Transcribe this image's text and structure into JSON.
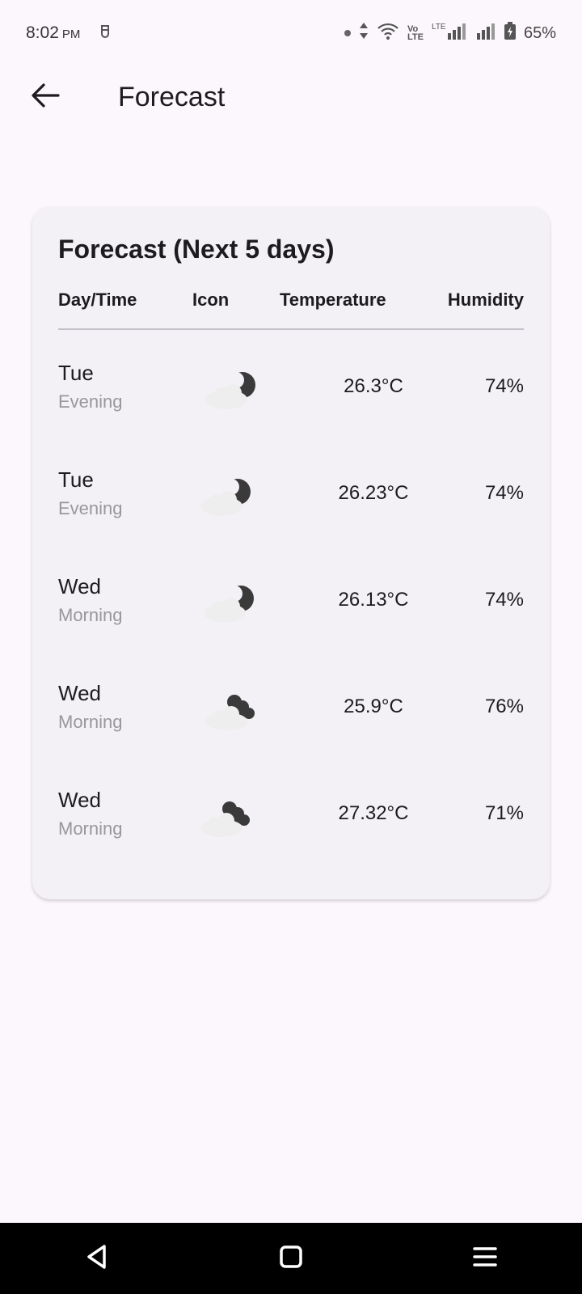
{
  "status_bar": {
    "time": "8:02",
    "ampm": "PM",
    "battery": "65%",
    "icons": [
      "notification-icon",
      "data-arrows-icon",
      "wifi-icon",
      "volte-icon",
      "lte-signal-icon",
      "signal-icon",
      "battery-charging-icon"
    ]
  },
  "app_bar": {
    "title": "Forecast",
    "back_icon": "arrow-left-icon"
  },
  "card": {
    "title": "Forecast (Next 5 days)",
    "headers": {
      "day": "Day/Time",
      "icon": "Icon",
      "temp": "Temperature",
      "humidity": "Humidity"
    },
    "rows": [
      {
        "day": "Tue",
        "part": "Evening",
        "icon": "night-cloudy-icon",
        "temp": "26.3°C",
        "humidity": "74%"
      },
      {
        "day": "Tue",
        "part": "Evening",
        "icon": "night-cloudy-icon",
        "temp": "26.23°C",
        "humidity": "74%"
      },
      {
        "day": "Wed",
        "part": "Morning",
        "icon": "night-cloudy-icon",
        "temp": "26.13°C",
        "humidity": "74%"
      },
      {
        "day": "Wed",
        "part": "Morning",
        "icon": "broken-clouds-icon",
        "temp": "25.9°C",
        "humidity": "76%"
      },
      {
        "day": "Wed",
        "part": "Morning",
        "icon": "broken-clouds-icon",
        "temp": "27.32°C",
        "humidity": "71%"
      }
    ]
  },
  "nav_bar": {
    "buttons": [
      "back-triangle-icon",
      "home-square-icon",
      "menu-lines-icon"
    ]
  }
}
